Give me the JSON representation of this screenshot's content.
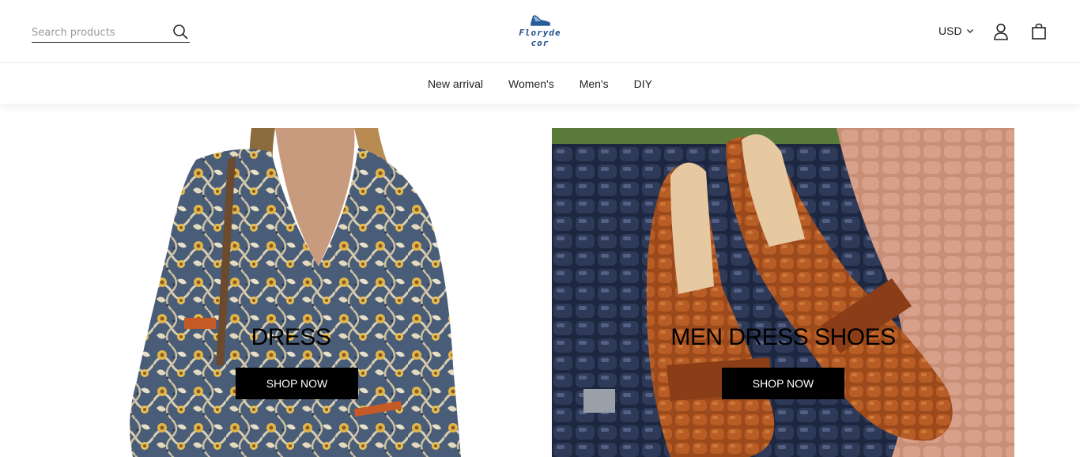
{
  "header": {
    "search": {
      "placeholder": "Search products",
      "value": ""
    },
    "logo": {
      "line1": "Floryde",
      "line2": "cor"
    },
    "currency": "USD",
    "icons": {
      "search": "search-icon",
      "account": "user-icon",
      "cart": "shopping-bag-icon",
      "currency_chevron": "chevron-down-icon"
    }
  },
  "nav": {
    "items": [
      {
        "label": "New arrival"
      },
      {
        "label": "Women's"
      },
      {
        "label": "Men's"
      },
      {
        "label": "DIY"
      }
    ]
  },
  "banners": [
    {
      "title": "DRESS",
      "button": "SHOP NOW",
      "image": "floral-print-dress-photo"
    },
    {
      "title": "MEN DRESS SHOES",
      "button": "SHOP NOW",
      "image": "brown-crocodile-loafers-photo"
    }
  ],
  "colors": {
    "accent": "#000000",
    "logo": "#1f4f8a"
  }
}
